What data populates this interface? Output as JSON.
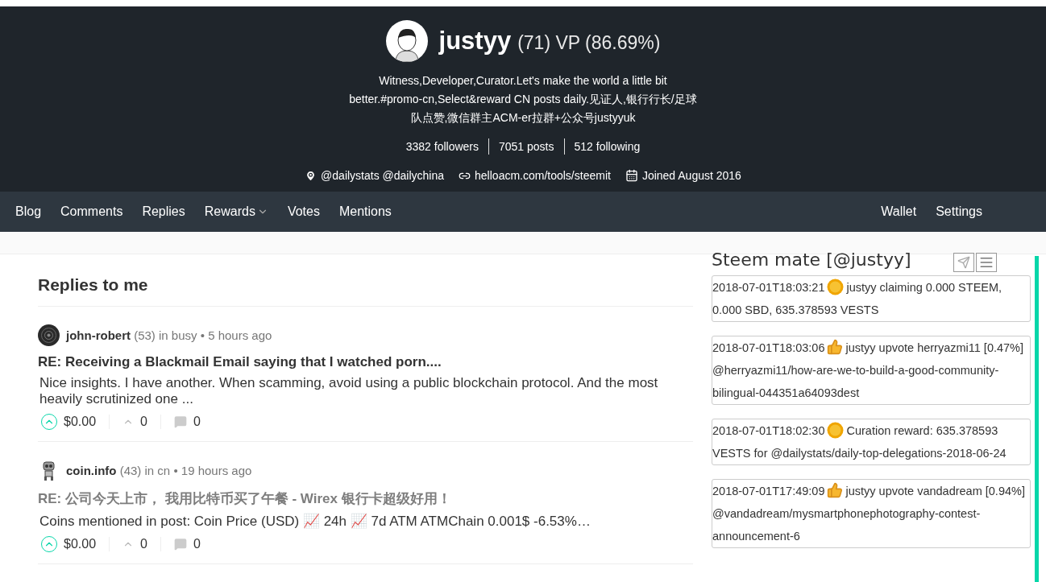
{
  "profile": {
    "name": "justyy",
    "reputation": "(71)",
    "vp": "VP (86.69%)",
    "about": "Witness,Developer,Curator.Let's make the world a little bit better.#promo-cn,Select&reward CN posts daily.见证人,银行行长/足球队点赞,微信群主ACM-er拉群+公众号justyyuk",
    "stats": [
      "3382 followers",
      "7051 posts",
      "512 following"
    ],
    "meta": [
      {
        "kind": "location",
        "text": "@dailystats @dailychina"
      },
      {
        "kind": "link",
        "text": "helloacm.com/tools/steemit"
      },
      {
        "kind": "calendar",
        "text": "Joined August 2016"
      }
    ]
  },
  "nav": {
    "left": [
      {
        "label": "Blog",
        "has_menu": false
      },
      {
        "label": "Comments",
        "has_menu": false
      },
      {
        "label": "Replies",
        "has_menu": false
      },
      {
        "label": "Rewards",
        "has_menu": true
      },
      {
        "label": "Votes",
        "has_menu": false
      },
      {
        "label": "Mentions",
        "has_menu": false
      }
    ],
    "right": [
      {
        "label": "Wallet",
        "has_menu": false
      },
      {
        "label": "Settings",
        "has_menu": false
      }
    ]
  },
  "replies": {
    "heading": "Replies to me",
    "items": [
      {
        "author": "john-robert",
        "reputation": "(53)",
        "where": "in busy • 5 hours ago",
        "title": "RE: Receiving a Blackmail Email saying that I watched porn....",
        "visited": false,
        "body": "Nice insights. I have another. When scamming, avoid using a public blockchain protocol. And the most heavily scrutinized one ...",
        "payout": "$0.00",
        "votes": "0",
        "comments": "0"
      },
      {
        "author": "coin.info",
        "reputation": "(43)",
        "where": "in cn • 19 hours ago",
        "title": "RE: 公司今天上市， 我用比特币买了午餐 - Wirex 银行卡超级好用！",
        "visited": true,
        "body": "Coins mentioned in post: Coin Price (USD) 📈 24h 📈 7d ATM ATMChain 0.001$ -6.53%…",
        "payout": "$0.00",
        "votes": "0",
        "comments": "0"
      }
    ]
  },
  "steem_mate": {
    "title": "Steem mate [@justyy]",
    "entries": [
      {
        "time": "2018-07-01T18:03:21",
        "kind": "coin",
        "text": "justyy claiming 0.000 STEEM, 0.000 SBD, 635.378593 VESTS"
      },
      {
        "time": "2018-07-01T18:03:06",
        "kind": "upvote",
        "text": "justyy upvote herryazmi11 [0.47%] @herryazmi11/how-are-we-to-build-a-good-community-bilingual-044351a64093dest"
      },
      {
        "time": "2018-07-01T18:02:30",
        "kind": "coin",
        "text": "Curation reward: 635.378593 VESTS for @dailystats/daily-top-delegations-2018-06-24"
      },
      {
        "time": "2018-07-01T17:49:09",
        "kind": "upvote",
        "text": "justyy upvote vandadream [0.94%] @vandadream/mysmartphonephotography-contest-announcement-6"
      }
    ]
  }
}
